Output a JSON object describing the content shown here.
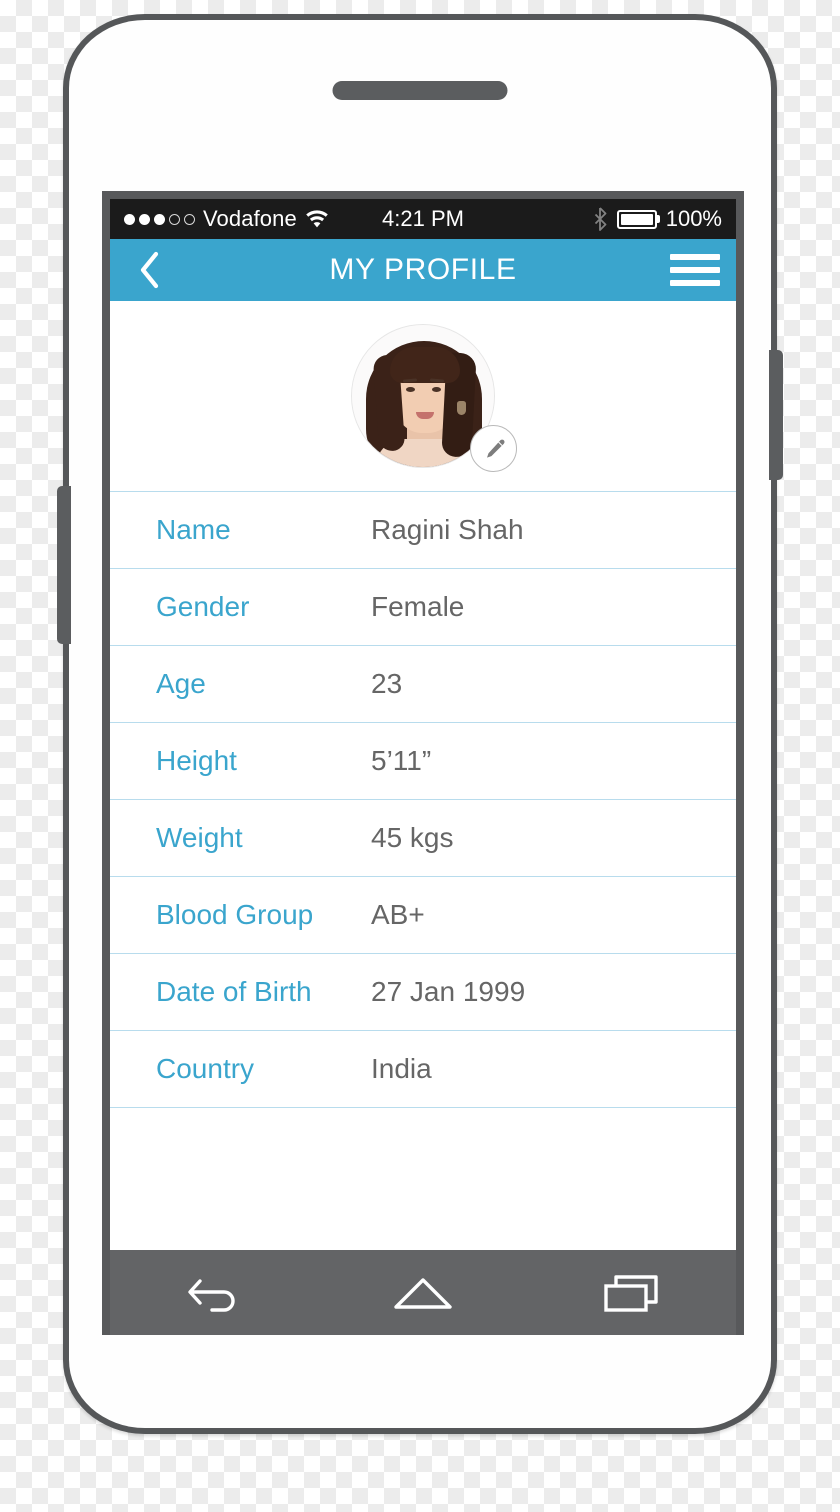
{
  "status_bar": {
    "signal_dots_filled": 3,
    "signal_dots_total": 5,
    "carrier": "Vodafone",
    "wifi_icon": "wifi-icon",
    "time": "4:21 PM",
    "bluetooth_icon": "bluetooth-icon",
    "battery_icon": "battery-full-icon",
    "battery_percent": "100%"
  },
  "header": {
    "back_icon": "chevron-left-icon",
    "title": "MY PROFILE",
    "menu_icon": "hamburger-menu-icon"
  },
  "profile": {
    "avatar_alt": "profile-photo",
    "edit_icon": "pencil-icon"
  },
  "info": {
    "rows": [
      {
        "label": "Name",
        "value": "Ragini Shah"
      },
      {
        "label": "Gender",
        "value": "Female"
      },
      {
        "label": "Age",
        "value": "23"
      },
      {
        "label": "Height",
        "value": "5’11”"
      },
      {
        "label": "Weight",
        "value": "45 kgs"
      },
      {
        "label": "Blood Group",
        "value": "AB+"
      },
      {
        "label": "Date of Birth",
        "value": "27 Jan 1999"
      },
      {
        "label": "Country",
        "value": "India"
      }
    ]
  },
  "nav_bar": {
    "back_icon": "android-back-icon",
    "home_icon": "android-home-icon",
    "recents_icon": "android-recents-icon"
  },
  "colors": {
    "accent": "#3aa5cd",
    "divider": "#b8dced",
    "value_text": "#666666",
    "status_bar_bg": "#1b1b1b",
    "nav_bar_bg": "#636466",
    "frame": "#555759"
  }
}
